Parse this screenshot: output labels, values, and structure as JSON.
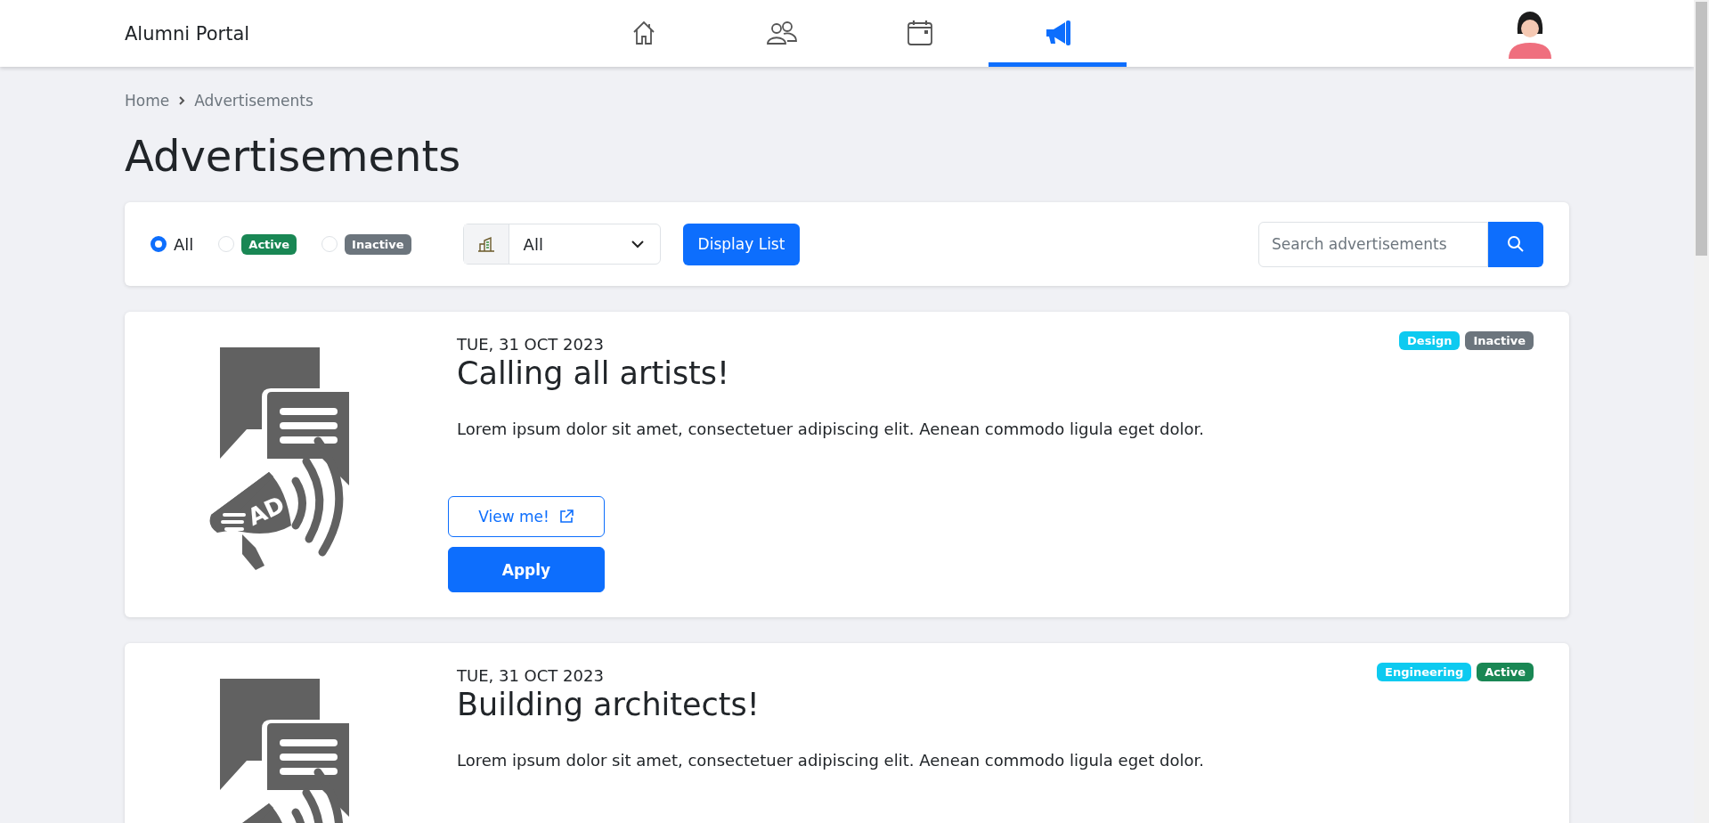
{
  "header": {
    "brand": "Alumni Portal",
    "nav": [
      {
        "kind": "home",
        "selected": false
      },
      {
        "kind": "people",
        "selected": false
      },
      {
        "kind": "calendar",
        "selected": false
      },
      {
        "kind": "megaphone",
        "selected": true
      }
    ]
  },
  "breadcrumb": [
    "Home",
    "Advertisements"
  ],
  "page_title": "Advertisements",
  "filters": {
    "status_options": [
      {
        "kind": "plain",
        "label": "All",
        "selected": true
      },
      {
        "kind": "badge",
        "label": "Active",
        "selected": false,
        "color": "#198754"
      },
      {
        "kind": "badge",
        "label": "Inactive",
        "selected": false,
        "color": "#6c757d"
      }
    ],
    "category_select": {
      "value": "All"
    },
    "display_button": "Display List",
    "search": {
      "placeholder": "Search advertisements"
    }
  },
  "ads": [
    {
      "date": "TUE, 31 OCT 2023",
      "title": "Calling all artists!",
      "body": "Lorem ipsum dolor sit amet, consectetuer adipiscing elit. Aenean commodo ligula eget dolor.",
      "art_label": "AD",
      "tags": [
        {
          "label": "Design",
          "color": "#0dcaf0"
        },
        {
          "label": "Inactive",
          "color": "#6c757d"
        }
      ],
      "buttons": [
        {
          "kind": "outline",
          "label": "View me!"
        },
        {
          "kind": "primary",
          "label": "Apply"
        }
      ]
    },
    {
      "date": "TUE, 31 OCT 2023",
      "title": "Building architects!",
      "body": "Lorem ipsum dolor sit amet, consectetuer adipiscing elit. Aenean commodo ligula eget dolor.",
      "tags": [
        {
          "label": "Engineering",
          "color": "#0dcaf0"
        },
        {
          "label": "Active",
          "color": "#198754"
        }
      ]
    }
  ]
}
